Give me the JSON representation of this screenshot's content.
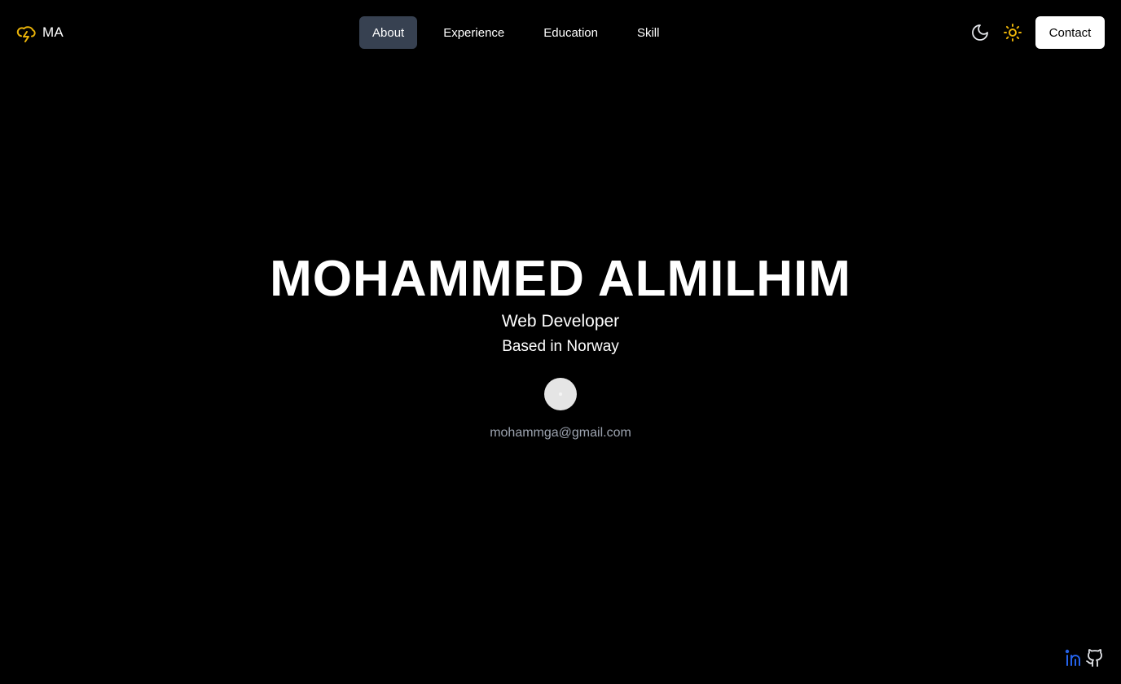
{
  "header": {
    "brand_text": "MA",
    "brand_icon": "cloud-lightning-icon",
    "nav": {
      "items": [
        {
          "label": "About",
          "active": true
        },
        {
          "label": "Experience",
          "active": false
        },
        {
          "label": "Education",
          "active": false
        },
        {
          "label": "Skill",
          "active": false
        }
      ]
    },
    "theme_toggle": {
      "dark_icon": "moon-icon",
      "light_icon": "sun-icon"
    },
    "contact_label": "Contact"
  },
  "hero": {
    "name": "MOHAMMED ALMILHIM",
    "role": "Web Developer",
    "location": "Based in Norway",
    "avatar_icon": "avatar",
    "email": "mohammga@gmail.com"
  },
  "social": {
    "linkedin_icon": "linkedin-icon",
    "github_icon": "github-icon"
  },
  "colors": {
    "background": "#000000",
    "text": "#ffffff",
    "nav_active_bg": "#374151",
    "accent_yellow": "#eab308",
    "muted_text": "#9ca3af",
    "linkedin_blue": "#2563eb",
    "contact_bg": "#ffffff"
  }
}
